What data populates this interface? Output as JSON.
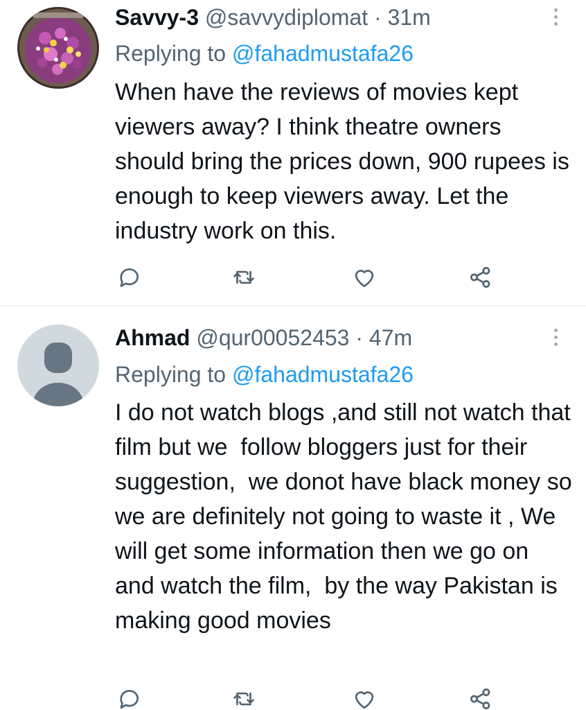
{
  "tweets": [
    {
      "display_name": "Savvy-3",
      "handle": "@savvydiplomat",
      "separator": "·",
      "time": "31m",
      "replying_prefix": "Replying to ",
      "replying_to": "@fahadmustafa26",
      "text": "When have the reviews of movies kept viewers away? I think theatre owners should bring the prices down, 900 rupees is enough to keep viewers away. Let the industry work on this.",
      "avatar": "flower-arrangement-photo",
      "actions": [
        "reply-icon",
        "retweet-icon",
        "like-icon",
        "share-icon"
      ]
    },
    {
      "display_name": "Ahmad",
      "handle": "@qur00052453",
      "separator": "·",
      "time": "47m",
      "replying_prefix": "Replying to ",
      "replying_to": "@fahadmustafa26",
      "text": "I do not watch blogs ,and still not watch that film but we  follow bloggers just for their suggestion,  we donot have black money so we are definitely not going to waste it , We will get some information then we go on and watch the film,  by the way Pakistan is making good movies",
      "avatar": "default-profile-avatar",
      "actions": [
        "reply-icon",
        "retweet-icon",
        "like-icon",
        "share-icon"
      ]
    }
  ],
  "colors": {
    "text_primary": "#0f1419",
    "text_secondary": "#536471",
    "link": "#1d9bf0",
    "divider": "#eff3f4",
    "default_avatar_bg": "#cfd9de"
  }
}
